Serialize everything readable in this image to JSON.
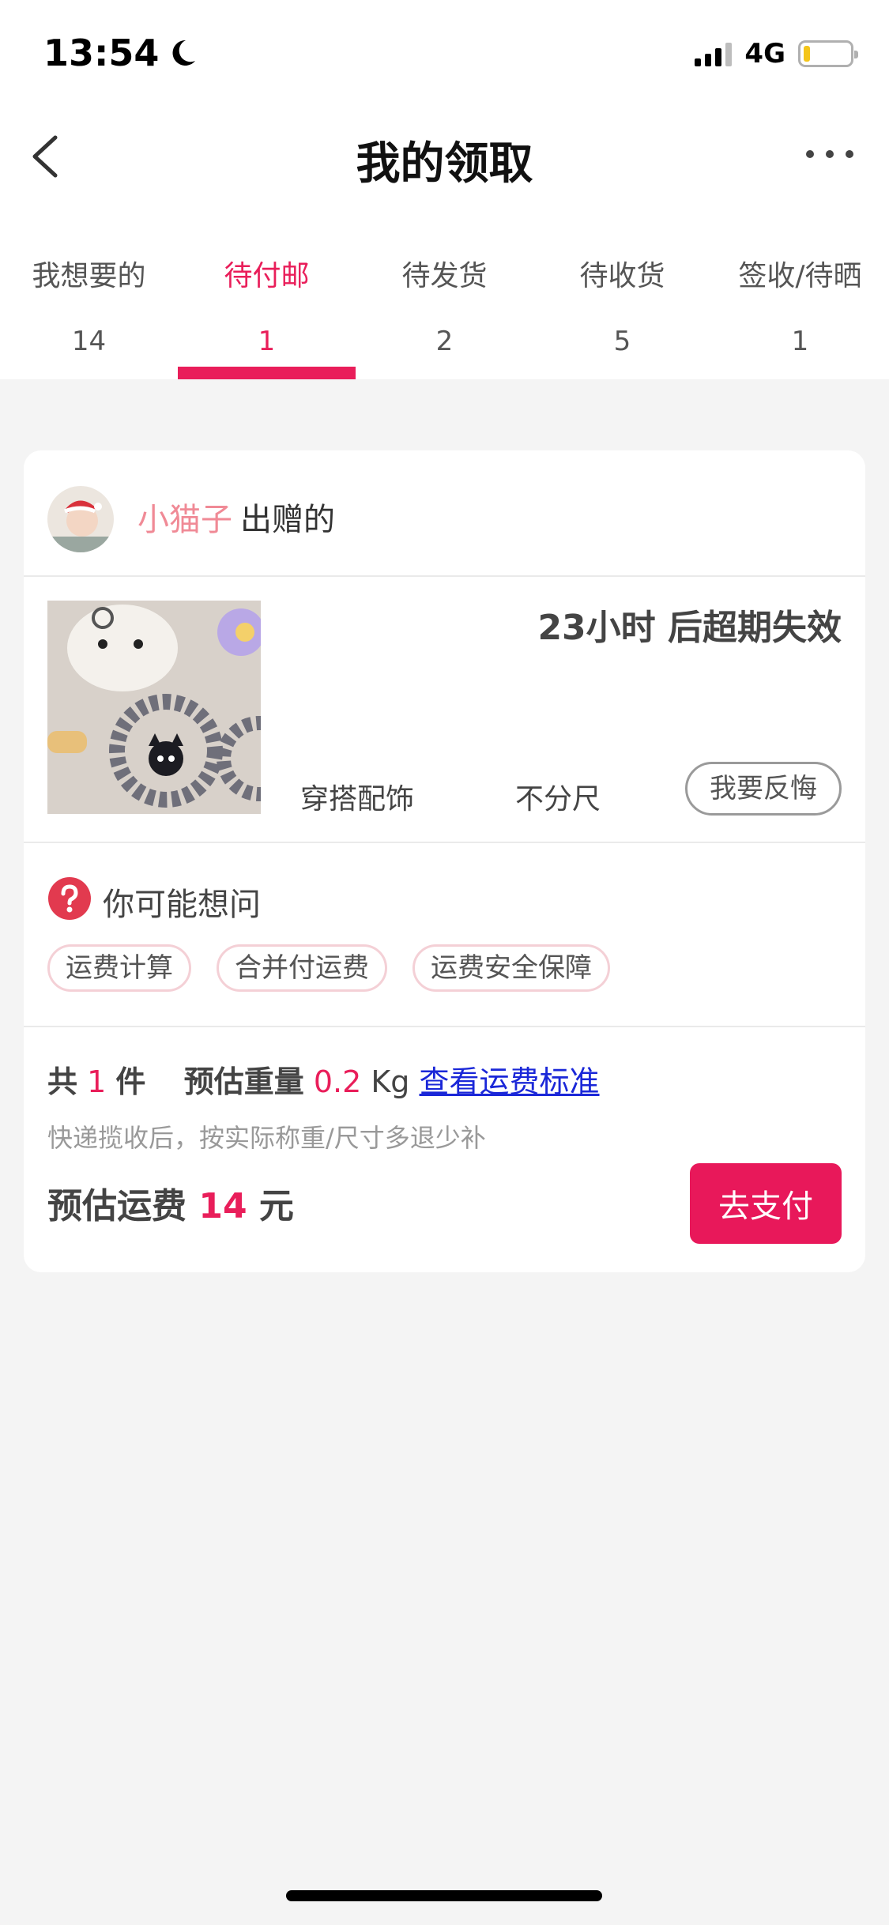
{
  "status_bar": {
    "time": "13:54",
    "network": "4G"
  },
  "nav": {
    "title": "我的领取"
  },
  "tabs": [
    {
      "label": "我想要的",
      "count": "14"
    },
    {
      "label": "待付邮",
      "count": "1"
    },
    {
      "label": "待发货",
      "count": "2"
    },
    {
      "label": "待收货",
      "count": "5"
    },
    {
      "label": "签收/待晒",
      "count": "1"
    }
  ],
  "card": {
    "seller_name": "小猫子",
    "seller_suffix": "出赠的",
    "expire_text": "23小时 后超期失效",
    "category": "穿搭配饰",
    "size": "不分尺",
    "regret_button": "我要反悔",
    "faq_title": "你可能想问",
    "chips": [
      "运费计算",
      "合并付运费",
      "运费安全保障"
    ],
    "summary": {
      "prefix": "共",
      "count": "1",
      "unit": "件",
      "weight_label": "预估重量",
      "weight_value": "0.2",
      "weight_unit": "Kg",
      "link": "查看运费标准"
    },
    "note": "快递揽收后，按实际称重/尺寸多退少补",
    "fee": {
      "label": "预估运费",
      "value": "14",
      "unit": "元"
    },
    "pay_button": "去支付"
  },
  "colors": {
    "accent": "#e91e5a",
    "link": "#1a27d8"
  }
}
